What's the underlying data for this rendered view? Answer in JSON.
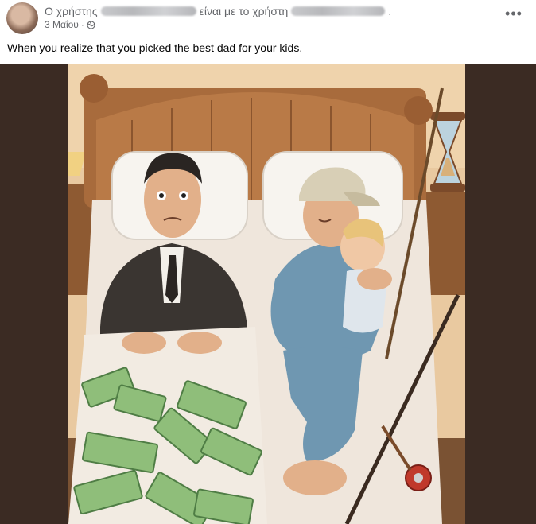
{
  "post": {
    "header_prefix": "Ο χρήστης",
    "header_middle": "είναι με το χρήστη",
    "header_suffix": ".",
    "date": "3 Μαΐου",
    "date_separator": "·",
    "privacy_icon": "globe-icon",
    "more_label": "•••",
    "text": "When you realize that you picked the best dad for your kids."
  },
  "colors": {
    "meta_text": "#65676b",
    "body_text": "#050505",
    "media_background": "#3b2b23"
  }
}
